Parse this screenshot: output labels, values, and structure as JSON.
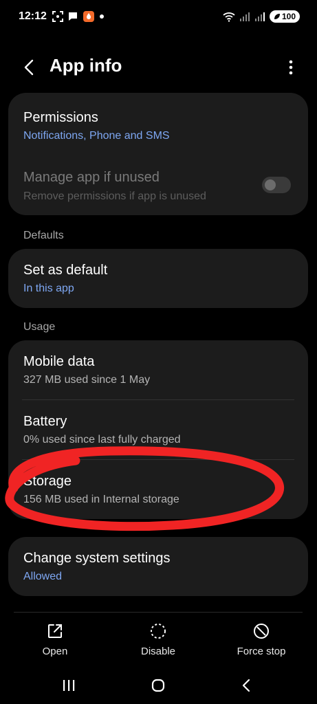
{
  "status_bar": {
    "time": "12:12",
    "battery": "100"
  },
  "app_bar": {
    "title": "App info"
  },
  "permissions": {
    "title": "Permissions",
    "subtitle": "Notifications, Phone and SMS"
  },
  "manage_unused": {
    "title": "Manage app if unused",
    "subtitle": "Remove permissions if app is unused",
    "enabled": false
  },
  "defaults_section": {
    "label": "Defaults"
  },
  "set_default": {
    "title": "Set as default",
    "subtitle": "In this app"
  },
  "usage_section": {
    "label": "Usage"
  },
  "mobile_data": {
    "title": "Mobile data",
    "subtitle": "327 MB used since 1 May"
  },
  "battery": {
    "title": "Battery",
    "subtitle": "0% used since last fully charged"
  },
  "storage": {
    "title": "Storage",
    "subtitle": "156 MB used in Internal storage"
  },
  "change_settings": {
    "title": "Change system settings",
    "subtitle": "Allowed"
  },
  "actions": {
    "open": "Open",
    "disable": "Disable",
    "force_stop": "Force stop"
  },
  "colors": {
    "accent_blue": "#7ea7f2",
    "annotation_red": "#f02424",
    "card_bg": "#1c1c1c"
  }
}
